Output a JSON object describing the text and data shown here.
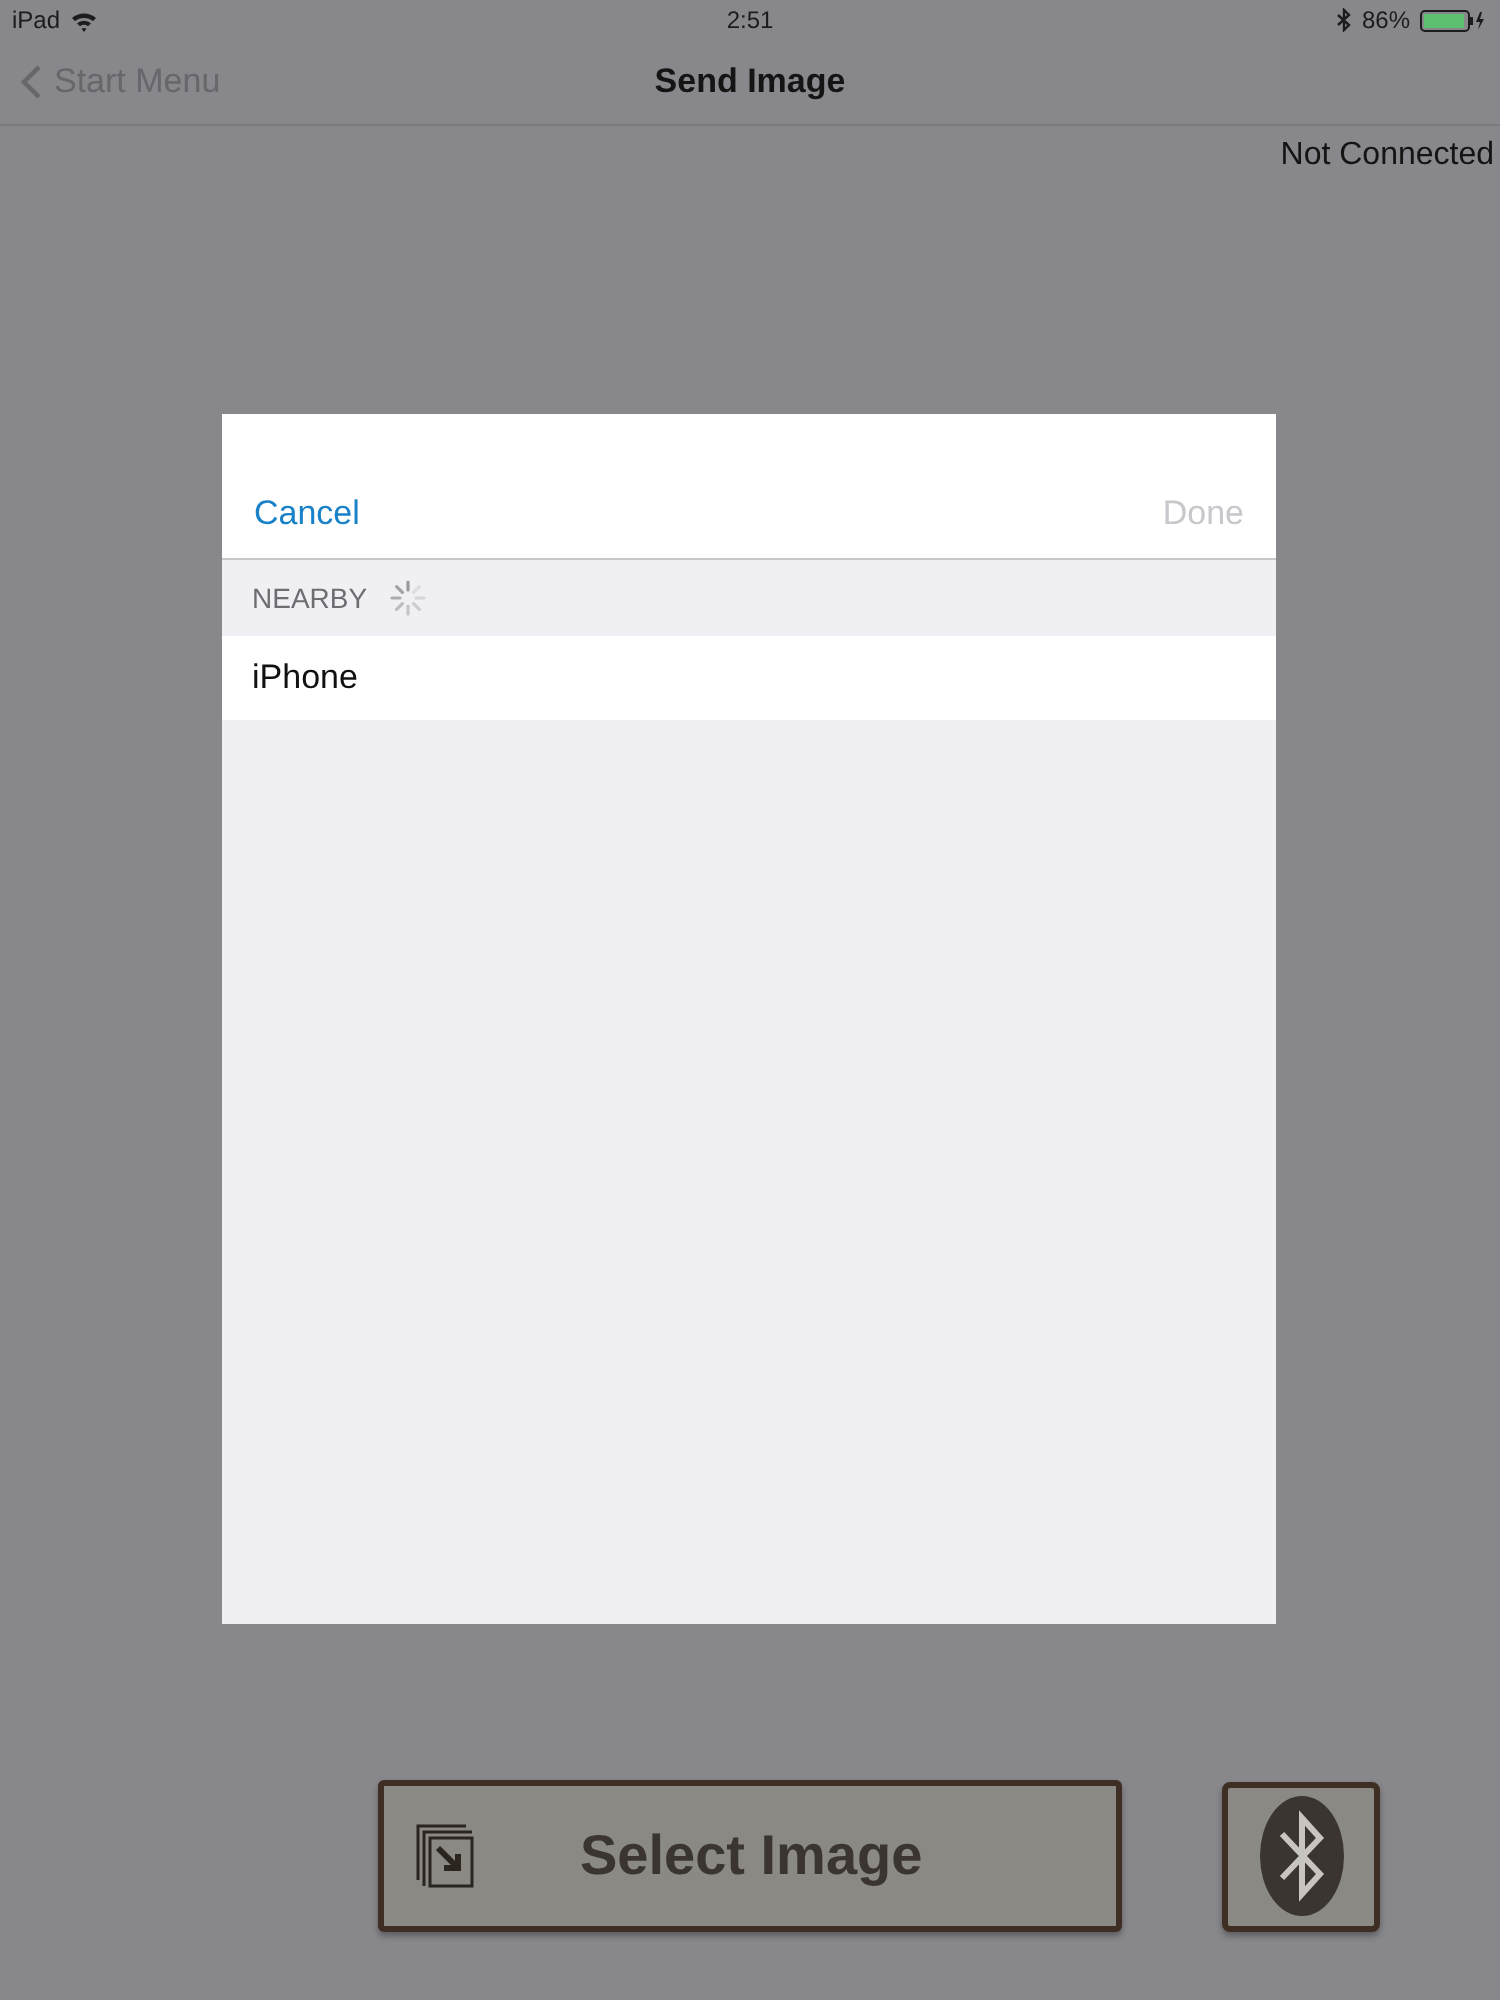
{
  "status_bar": {
    "carrier": "iPad",
    "time": "2:51",
    "battery": "86%"
  },
  "nav_bar": {
    "back": "Start Menu",
    "title": "Send Image"
  },
  "connection_status": "Not Connected",
  "picker": {
    "cancel": "Cancel",
    "done": {
      "label": "Done",
      "disabled": true
    },
    "section": "NEARBY",
    "devices": [
      {
        "name": "iPhone",
        "selected": false
      }
    ]
  },
  "select_button": "Select Image"
}
